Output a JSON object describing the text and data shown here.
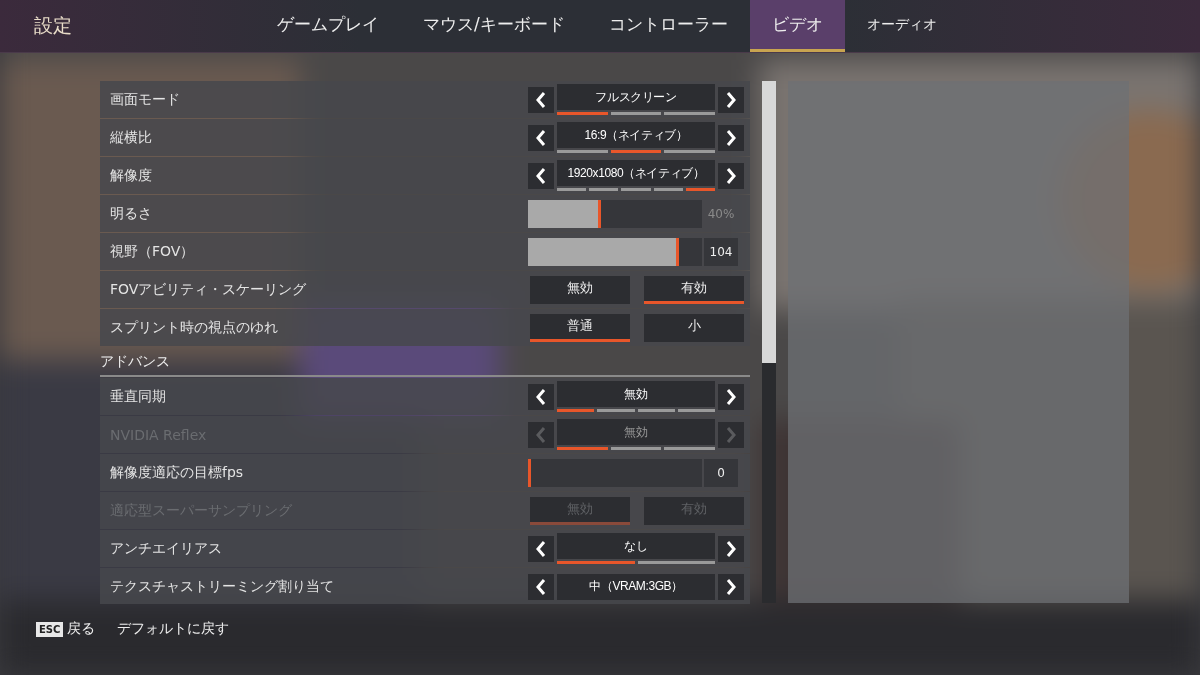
{
  "header": {
    "title": "設定"
  },
  "tabs": [
    {
      "label": "ゲームプレイ",
      "selected": false
    },
    {
      "label": "マウス/キーボード",
      "selected": false
    },
    {
      "label": "コントローラー",
      "selected": false
    },
    {
      "label": "ビデオ",
      "selected": true
    },
    {
      "label": "オーディオ",
      "selected": false
    }
  ],
  "settings": [
    {
      "kind": "selector",
      "label": "画面モード",
      "disabled": false,
      "value": "フルスクリーン",
      "segments": [
        {
          "selected": true
        },
        {
          "selected": false
        },
        {
          "selected": false
        }
      ]
    },
    {
      "kind": "selector",
      "label": "縦横比",
      "disabled": false,
      "value": "16:9（ネイティブ）",
      "segments": [
        {
          "selected": false
        },
        {
          "selected": true
        },
        {
          "selected": false
        }
      ]
    },
    {
      "kind": "selector",
      "label": "解像度",
      "disabled": false,
      "value": "1920x1080（ネイティブ）",
      "segments": [
        {
          "selected": false
        },
        {
          "selected": false
        },
        {
          "selected": false
        },
        {
          "selected": false
        },
        {
          "selected": true
        }
      ]
    },
    {
      "kind": "slider",
      "label": "明るさ",
      "disabled": false,
      "level": 0.4,
      "reading": "40%",
      "reading_boxed": false
    },
    {
      "kind": "slider",
      "label": "視野（FOV）",
      "disabled": false,
      "level": 0.85,
      "reading": "104",
      "reading_boxed": true
    },
    {
      "kind": "toggle",
      "label": "FOVアビリティ・スケーリング",
      "disabled": false,
      "options": [
        {
          "label": "無効",
          "selected": false
        },
        {
          "label": "有効",
          "selected": true
        }
      ]
    },
    {
      "kind": "toggle",
      "label": "スプリント時の視点のゆれ",
      "disabled": false,
      "options": [
        {
          "label": "普通",
          "selected": true
        },
        {
          "label": "小",
          "selected": false
        }
      ]
    },
    {
      "kind": "section",
      "label": "アドバンス"
    },
    {
      "kind": "selector",
      "label": "垂直同期",
      "disabled": false,
      "value": "無効",
      "segments": [
        {
          "selected": true
        },
        {
          "selected": false
        },
        {
          "selected": false
        },
        {
          "selected": false
        }
      ]
    },
    {
      "kind": "selector",
      "label": "NVIDIA Reflex",
      "disabled": true,
      "value": "無効",
      "segments": [
        {
          "selected": true
        },
        {
          "selected": false
        },
        {
          "selected": false
        }
      ]
    },
    {
      "kind": "slider",
      "label": "解像度適応の目標fps",
      "disabled": false,
      "level": 0,
      "reading": "0",
      "reading_boxed": true
    },
    {
      "kind": "toggle",
      "label": "適応型スーパーサンプリング",
      "disabled": true,
      "options": [
        {
          "label": "無効",
          "selected": true
        },
        {
          "label": "有効",
          "selected": false
        }
      ]
    },
    {
      "kind": "selector",
      "label": "アンチエイリアス",
      "disabled": false,
      "value": "なし",
      "segments": [
        {
          "selected": true
        },
        {
          "selected": false
        }
      ]
    },
    {
      "kind": "selector",
      "label": "テクスチャストリーミング割り当て",
      "disabled": false,
      "value": "中（VRAM:3GB）"
    }
  ],
  "footer": {
    "key": "ESC",
    "back": "戻る",
    "reset": "デフォルトに戻す"
  }
}
